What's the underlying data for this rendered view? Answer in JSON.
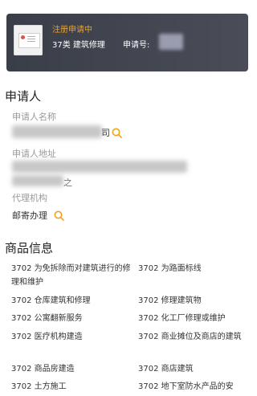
{
  "status_card": {
    "status": "注册申请中",
    "category": "37类 建筑修理",
    "application_no_label": "申请号:"
  },
  "applicant": {
    "section_title": "申请人",
    "name_label": "申请人名称",
    "name_tail": "司",
    "address_label": "申请人地址",
    "address_tail": "之",
    "agency_label": "代理机构",
    "agency_value": "邮寄办理"
  },
  "goods": {
    "section_title": "商品信息",
    "items": [
      "3702 为免拆除而对建筑进行的修理和维护",
      "3702 为路面标线",
      "3702 仓库建筑和修理",
      "3702 修理建筑物",
      "3702 公寓翻新服务",
      "3702 化工厂修理或维护",
      "3702 医疗机构建造",
      "3702 商业摊位及商店的建筑",
      "3702 商品房建造",
      "3702 商店建筑",
      "3702 土方施工",
      "3702 地下室防水产品的安"
    ]
  },
  "colors": {
    "status_orange": "#f0a020",
    "card_bg": "#3f424d",
    "search_icon": "#f0a020"
  }
}
